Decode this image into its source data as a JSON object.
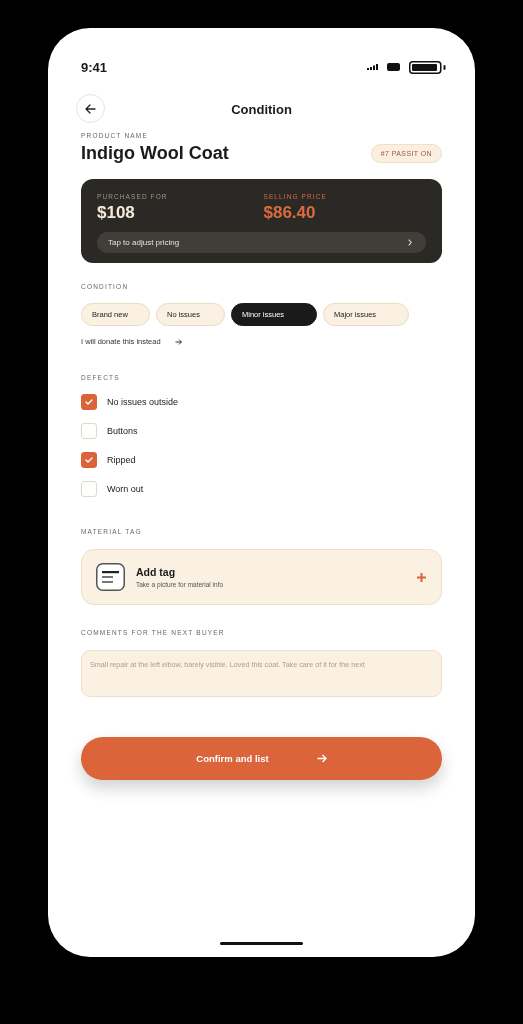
{
  "status_bar": {
    "time": "9:41"
  },
  "header": {
    "title": "Condition"
  },
  "product": {
    "label": "PRODUCT NAME",
    "name": "Indigo Wool Coat",
    "badge": "#7 PASSIT ON"
  },
  "pricing": {
    "purchased_label": "PURCHASED FOR",
    "purchased": "$108",
    "selling_label": "SELLING PRICE",
    "selling": "$86.40",
    "adjust": "Tap to adjust pricing"
  },
  "condition": {
    "label": "CONDITION",
    "options": [
      {
        "label": "Brand new",
        "selected": false
      },
      {
        "label": "No issues",
        "selected": false
      },
      {
        "label": "Minor issues",
        "selected": true
      },
      {
        "label": "Major issues",
        "selected": false
      }
    ],
    "donate_link": "I will donate this instead"
  },
  "defects": {
    "label": "DEFECTS",
    "items": [
      {
        "label": "No issues outside",
        "checked": true
      },
      {
        "label": "Buttons",
        "checked": false
      },
      {
        "label": "Ripped",
        "checked": true
      },
      {
        "label": "Worn out",
        "checked": false
      }
    ]
  },
  "material_tag": {
    "label": "MATERIAL TAG",
    "title": "Add tag",
    "subtitle": "Take a picture for material info"
  },
  "comments": {
    "label": "COMMENTS FOR THE NEXT BUYER",
    "placeholder": "Small repair at the left elbow, barely visible. Loved this coat. Take care of it for the next"
  },
  "confirm_button": "Confirm and list"
}
